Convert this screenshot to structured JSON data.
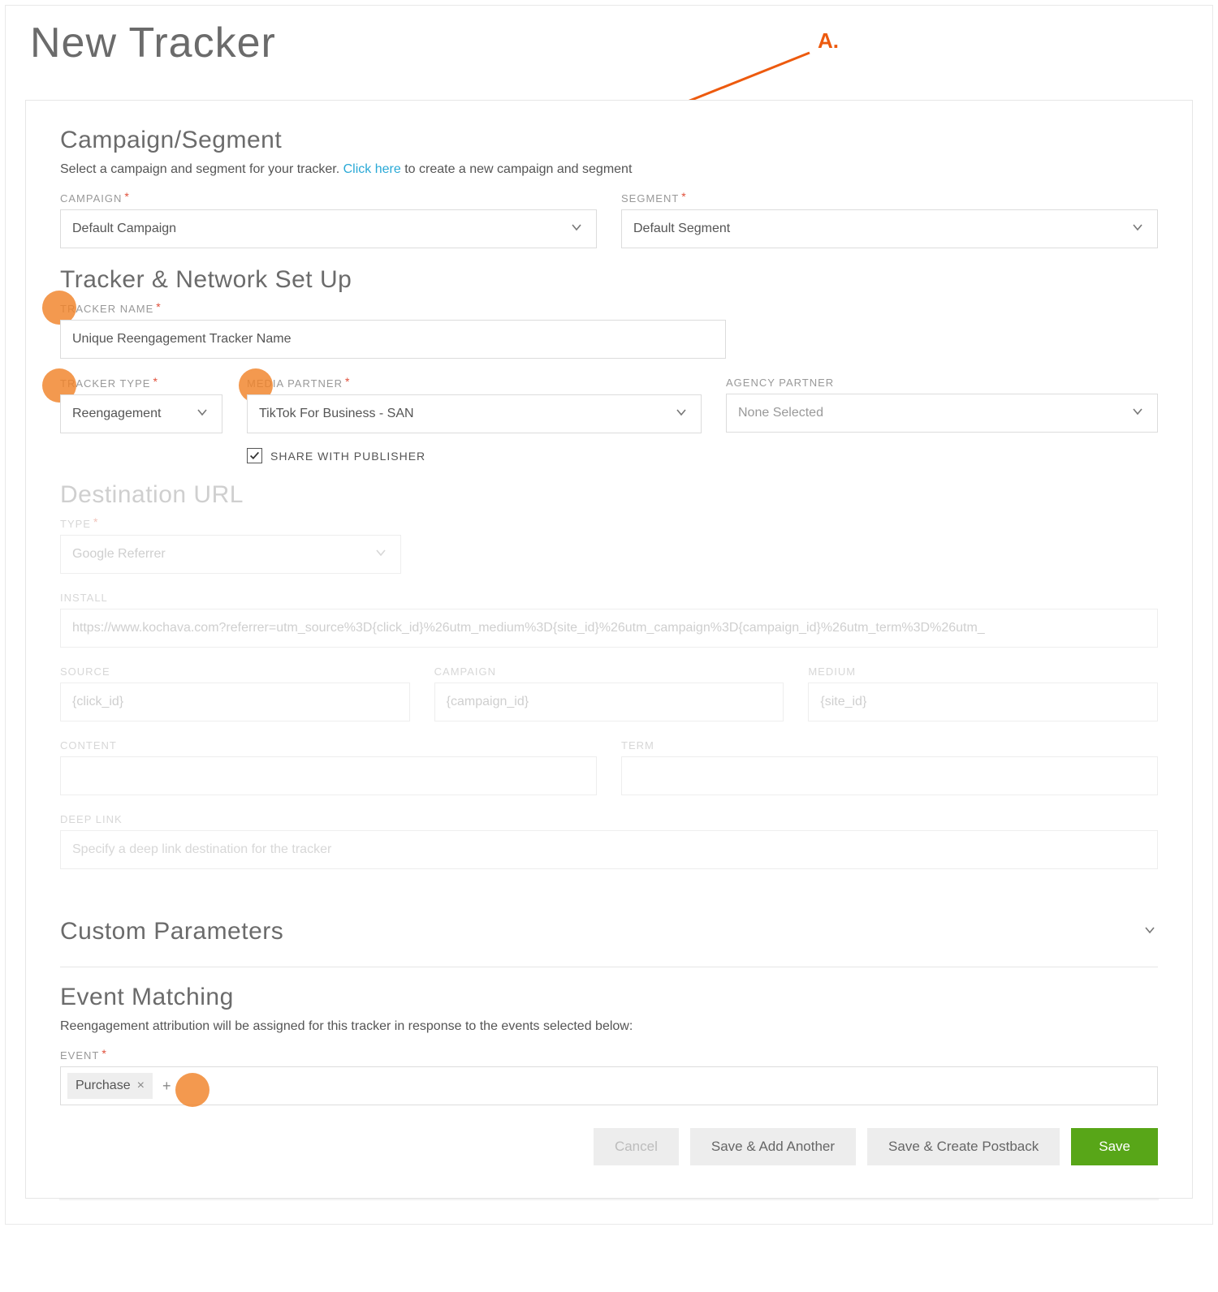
{
  "page_title": "New Tracker",
  "annotation_label": "A.",
  "campaign_segment": {
    "title": "Campaign/Segment",
    "desc_pre": "Select a campaign and segment for your tracker. ",
    "desc_link": "Click here",
    "desc_post": " to create a new campaign and segment",
    "campaign_label": "CAMPAIGN",
    "campaign_value": "Default Campaign",
    "segment_label": "SEGMENT",
    "segment_value": "Default Segment"
  },
  "tracker_setup": {
    "title": "Tracker & Network Set Up",
    "tracker_name_label": "TRACKER NAME",
    "tracker_name_value": "Unique Reengagement Tracker Name",
    "tracker_type_label": "TRACKER TYPE",
    "tracker_type_value": "Reengagement",
    "media_partner_label": "MEDIA PARTNER",
    "media_partner_value": "TikTok For Business - SAN",
    "agency_partner_label": "AGENCY PARTNER",
    "agency_partner_value": "None Selected",
    "share_checkbox_label": "SHARE WITH PUBLISHER",
    "share_checked": true
  },
  "destination": {
    "title": "Destination URL",
    "type_label": "TYPE",
    "type_value": "Google Referrer",
    "install_label": "INSTALL",
    "install_value": "https://www.kochava.com?referrer=utm_source%3D{click_id}%26utm_medium%3D{site_id}%26utm_campaign%3D{campaign_id}%26utm_term%3D%26utm_",
    "source_label": "SOURCE",
    "source_value": "{click_id}",
    "campaign_label": "CAMPAIGN",
    "campaign_value": "{campaign_id}",
    "medium_label": "MEDIUM",
    "medium_value": "{site_id}",
    "content_label": "CONTENT",
    "content_value": "",
    "term_label": "TERM",
    "term_value": "",
    "deeplink_label": "DEEP LINK",
    "deeplink_placeholder": "Specify a deep link destination for the tracker"
  },
  "custom_params": {
    "title": "Custom Parameters"
  },
  "event_matching": {
    "title": "Event Matching",
    "desc": "Reengagement attribution will be assigned for this tracker in response to the events selected below:",
    "event_label": "EVENT",
    "tag_value": "Purchase"
  },
  "actions": {
    "cancel": "Cancel",
    "save_add": "Save & Add Another",
    "save_postback": "Save & Create Postback",
    "save": "Save"
  }
}
